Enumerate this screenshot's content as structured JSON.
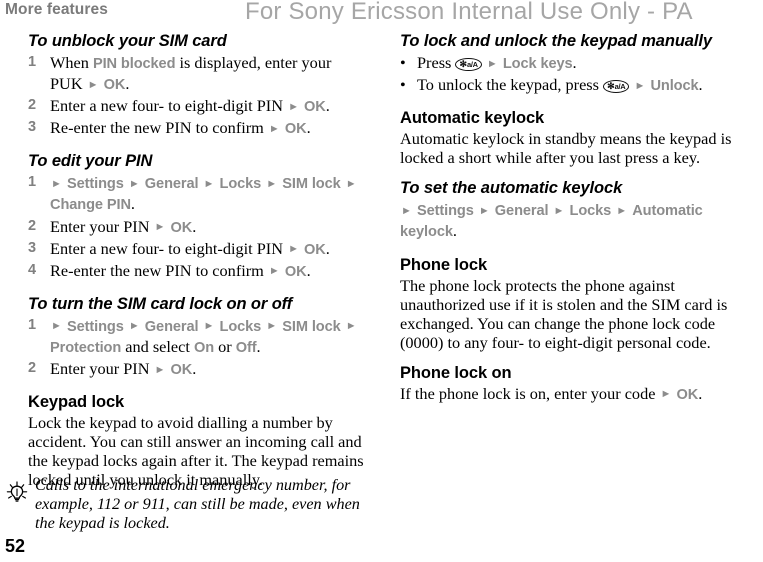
{
  "header": {
    "running_head": "More features",
    "watermark": "For Sony Ericsson Internal Use Only - PA"
  },
  "page_number": "52",
  "colors": {
    "ui_term_gray": "#8c8c8c",
    "running_head_gray": "#7b7b7b",
    "watermark_gray": "#a6a6a6",
    "body_black": "#000000"
  },
  "icons": {
    "tip": "lightbulb-icon",
    "arrow": "►",
    "bullet": "•",
    "star_key_label": "✻",
    "star_key_sub": "a/A"
  },
  "left_column": {
    "sections": [
      {
        "heading": "To unblock your SIM card",
        "heading_style": "procedure",
        "steps": [
          {
            "marker": "1",
            "parts": [
              {
                "t": "When ",
                "s": "body"
              },
              {
                "t": "PIN blocked",
                "s": "ui"
              },
              {
                "t": " is displayed, enter your PUK ",
                "s": "body"
              },
              {
                "t": "►",
                "s": "arrow"
              },
              {
                "t": " ",
                "s": "body"
              },
              {
                "t": "OK",
                "s": "ui"
              },
              {
                "t": ".",
                "s": "body"
              }
            ]
          },
          {
            "marker": "2",
            "parts": [
              {
                "t": "Enter a new four- to eight-digit PIN ",
                "s": "body"
              },
              {
                "t": "►",
                "s": "arrow"
              },
              {
                "t": " ",
                "s": "body"
              },
              {
                "t": "OK",
                "s": "ui"
              },
              {
                "t": ".",
                "s": "body"
              }
            ]
          },
          {
            "marker": "3",
            "parts": [
              {
                "t": "Re-enter the new PIN to confirm ",
                "s": "body"
              },
              {
                "t": "►",
                "s": "arrow"
              },
              {
                "t": " ",
                "s": "body"
              },
              {
                "t": "OK",
                "s": "ui"
              },
              {
                "t": ".",
                "s": "body"
              }
            ]
          }
        ]
      },
      {
        "heading": "To edit your PIN",
        "heading_style": "procedure",
        "steps": [
          {
            "marker": "1",
            "parts": [
              {
                "t": "►",
                "s": "arrow"
              },
              {
                "t": " ",
                "s": "body"
              },
              {
                "t": "Settings",
                "s": "ui"
              },
              {
                "t": " ",
                "s": "body"
              },
              {
                "t": "►",
                "s": "arrow"
              },
              {
                "t": " ",
                "s": "body"
              },
              {
                "t": "General",
                "s": "ui"
              },
              {
                "t": " ",
                "s": "body"
              },
              {
                "t": "►",
                "s": "arrow"
              },
              {
                "t": " ",
                "s": "body"
              },
              {
                "t": "Locks",
                "s": "ui"
              },
              {
                "t": " ",
                "s": "body"
              },
              {
                "t": "►",
                "s": "arrow"
              },
              {
                "t": " ",
                "s": "body"
              },
              {
                "t": "SIM lock",
                "s": "ui"
              },
              {
                "t": " ",
                "s": "body"
              },
              {
                "t": "►",
                "s": "arrow"
              },
              {
                "t": " ",
                "s": "body"
              },
              {
                "t": "Change PIN",
                "s": "ui"
              },
              {
                "t": ".",
                "s": "body"
              }
            ]
          },
          {
            "marker": "2",
            "parts": [
              {
                "t": "Enter your PIN ",
                "s": "body"
              },
              {
                "t": "►",
                "s": "arrow"
              },
              {
                "t": " ",
                "s": "body"
              },
              {
                "t": "OK",
                "s": "ui"
              },
              {
                "t": ".",
                "s": "body"
              }
            ]
          },
          {
            "marker": "3",
            "parts": [
              {
                "t": "Enter a new four- to eight-digit PIN ",
                "s": "body"
              },
              {
                "t": "►",
                "s": "arrow"
              },
              {
                "t": " ",
                "s": "body"
              },
              {
                "t": "OK",
                "s": "ui"
              },
              {
                "t": ".",
                "s": "body"
              }
            ]
          },
          {
            "marker": "4",
            "parts": [
              {
                "t": "Re-enter the new PIN to confirm ",
                "s": "body"
              },
              {
                "t": "►",
                "s": "arrow"
              },
              {
                "t": " ",
                "s": "body"
              },
              {
                "t": "OK",
                "s": "ui"
              },
              {
                "t": ".",
                "s": "body"
              }
            ]
          }
        ]
      },
      {
        "heading": "To turn the SIM card lock on or off",
        "heading_style": "procedure",
        "steps": [
          {
            "marker": "1",
            "parts": [
              {
                "t": "►",
                "s": "arrow"
              },
              {
                "t": " ",
                "s": "body"
              },
              {
                "t": "Settings",
                "s": "ui"
              },
              {
                "t": " ",
                "s": "body"
              },
              {
                "t": "►",
                "s": "arrow"
              },
              {
                "t": " ",
                "s": "body"
              },
              {
                "t": "General",
                "s": "ui"
              },
              {
                "t": " ",
                "s": "body"
              },
              {
                "t": "►",
                "s": "arrow"
              },
              {
                "t": " ",
                "s": "body"
              },
              {
                "t": "Locks",
                "s": "ui"
              },
              {
                "t": " ",
                "s": "body"
              },
              {
                "t": "►",
                "s": "arrow"
              },
              {
                "t": " ",
                "s": "body"
              },
              {
                "t": "SIM lock",
                "s": "ui"
              },
              {
                "t": " ",
                "s": "body"
              },
              {
                "t": "►",
                "s": "arrow"
              },
              {
                "t": " ",
                "s": "body"
              },
              {
                "t": "Protection",
                "s": "ui"
              },
              {
                "t": " and select ",
                "s": "body"
              },
              {
                "t": "On",
                "s": "ui"
              },
              {
                "t": " or ",
                "s": "body"
              },
              {
                "t": "Off",
                "s": "ui"
              },
              {
                "t": ".",
                "s": "body"
              }
            ]
          },
          {
            "marker": "2",
            "parts": [
              {
                "t": "Enter your PIN ",
                "s": "body"
              },
              {
                "t": "►",
                "s": "arrow"
              },
              {
                "t": " ",
                "s": "body"
              },
              {
                "t": "OK",
                "s": "ui"
              },
              {
                "t": ".",
                "s": "body"
              }
            ]
          }
        ]
      },
      {
        "heading": "Keypad lock",
        "heading_style": "section",
        "paragraph": "Lock the keypad to avoid dialling a number by accident. You can still answer an incoming call and the keypad locks again after it. The keypad remains locked until you unlock it manually."
      }
    ],
    "note": {
      "icon": "lightbulb-icon",
      "text": "Calls to the international emergency number, for example, 112 or 911, can still be made, even when the keypad is locked."
    }
  },
  "right_column": {
    "sections": [
      {
        "heading": "To lock and unlock the keypad manually",
        "heading_style": "procedure",
        "steps": [
          {
            "marker": "•",
            "bullet": true,
            "parts": [
              {
                "t": "Press ",
                "s": "body"
              },
              {
                "t": "",
                "s": "key"
              },
              {
                "t": " ",
                "s": "body"
              },
              {
                "t": "►",
                "s": "arrow"
              },
              {
                "t": " ",
                "s": "body"
              },
              {
                "t": "Lock keys",
                "s": "ui"
              },
              {
                "t": ".",
                "s": "body"
              }
            ]
          },
          {
            "marker": "•",
            "bullet": true,
            "parts": [
              {
                "t": "To unlock the keypad, press ",
                "s": "body"
              },
              {
                "t": "",
                "s": "key"
              },
              {
                "t": " ",
                "s": "body"
              },
              {
                "t": "►",
                "s": "arrow"
              },
              {
                "t": " ",
                "s": "body"
              },
              {
                "t": "Unlock",
                "s": "ui"
              },
              {
                "t": ".",
                "s": "body"
              }
            ]
          }
        ]
      },
      {
        "heading": "Automatic keylock",
        "heading_style": "section",
        "paragraph": "Automatic keylock in standby means the keypad is locked a short while after you last press a key."
      },
      {
        "heading": "To set the automatic keylock",
        "heading_style": "procedure",
        "steps": [
          {
            "marker": "",
            "nomarker": true,
            "parts": [
              {
                "t": "►",
                "s": "arrow"
              },
              {
                "t": " ",
                "s": "body"
              },
              {
                "t": "Settings",
                "s": "ui"
              },
              {
                "t": " ",
                "s": "body"
              },
              {
                "t": "►",
                "s": "arrow"
              },
              {
                "t": " ",
                "s": "body"
              },
              {
                "t": "General",
                "s": "ui"
              },
              {
                "t": " ",
                "s": "body"
              },
              {
                "t": "►",
                "s": "arrow"
              },
              {
                "t": " ",
                "s": "body"
              },
              {
                "t": "Locks",
                "s": "ui"
              },
              {
                "t": " ",
                "s": "body"
              },
              {
                "t": "►",
                "s": "arrow"
              },
              {
                "t": " ",
                "s": "body"
              },
              {
                "t": "Automatic keylock",
                "s": "ui"
              },
              {
                "t": ".",
                "s": "body"
              }
            ]
          }
        ]
      },
      {
        "heading": "Phone lock",
        "heading_style": "section",
        "paragraph": "The phone lock protects the phone against unauthorized use if it is stolen and the SIM card is exchanged. You can change the phone lock code (0000) to any four- to eight-digit personal code."
      },
      {
        "heading": "Phone lock on",
        "heading_style": "section",
        "steps": [
          {
            "marker": "",
            "nomarker": true,
            "parts": [
              {
                "t": "If the phone lock is on, enter your code ",
                "s": "body"
              },
              {
                "t": "►",
                "s": "arrow"
              },
              {
                "t": " ",
                "s": "body"
              },
              {
                "t": "OK",
                "s": "ui"
              },
              {
                "t": ".",
                "s": "body"
              }
            ]
          }
        ]
      }
    ]
  }
}
